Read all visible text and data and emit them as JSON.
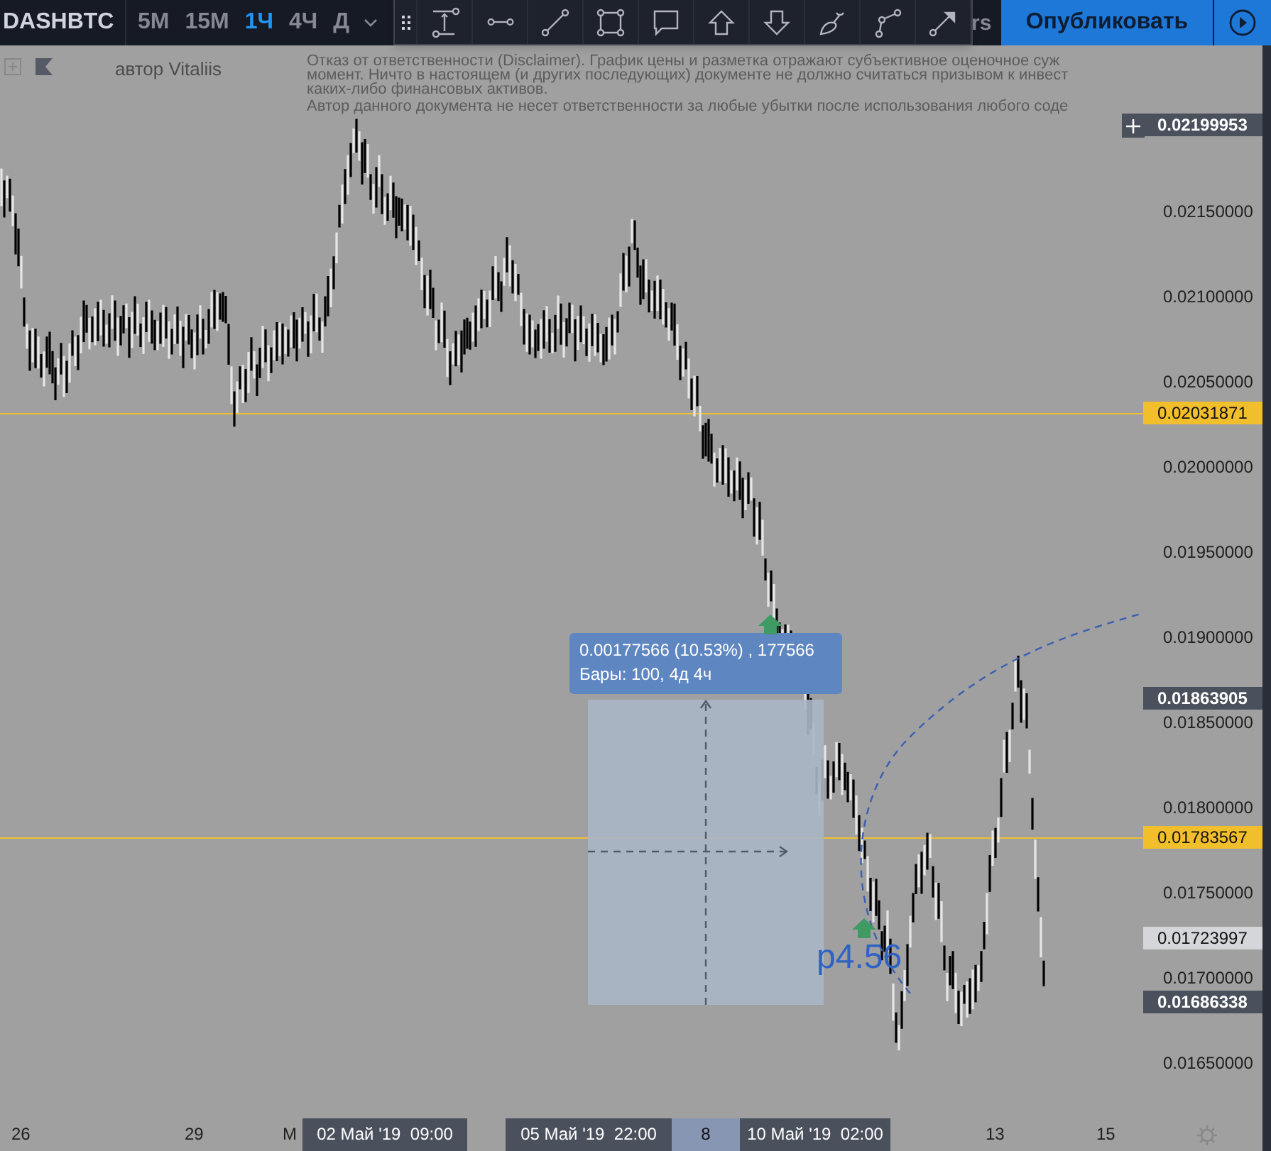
{
  "toolbar": {
    "symbol": "DASHBTC",
    "intervals": [
      {
        "label": "5M",
        "selected": false
      },
      {
        "label": "15M",
        "selected": false
      },
      {
        "label": "1Ч",
        "selected": true
      },
      {
        "label": "4Ч",
        "selected": false
      },
      {
        "label": "Д",
        "selected": false
      }
    ],
    "partial_text": "rs",
    "publish_button": "Опубликовать"
  },
  "legend": {
    "author": "автор Vitaliis"
  },
  "disclaimer": [
    "Отказ от ответственности (Disclaimer). График цены и разметка отражают субъективное оценочное суж",
    "момент. Ничто в настоящем (и других последующих) документе не должно считаться призывом к инвест",
    "каких-либо финансовых активов.",
    "Автор данного документа не несет ответственности за любые убытки после использования любого соде"
  ],
  "price_axis": {
    "ticks": [
      "0.02150000",
      "0.02100000",
      "0.02050000",
      "0.02000000",
      "0.01950000",
      "0.01900000",
      "0.01850000",
      "0.01800000",
      "0.01750000",
      "0.01700000",
      "0.01650000"
    ],
    "labels": [
      {
        "text": "0.02199953",
        "kind": "dark"
      },
      {
        "text": "0.02031871",
        "kind": "line"
      },
      {
        "text": "0.01863905",
        "kind": "dark"
      },
      {
        "text": "0.01783567",
        "kind": "line"
      },
      {
        "text": "0.01723997",
        "kind": "light"
      },
      {
        "text": "0.01686338",
        "kind": "dark"
      }
    ]
  },
  "time_axis": [
    {
      "text": "26",
      "kind": "plain"
    },
    {
      "text": "29",
      "kind": "plain"
    },
    {
      "text": "М",
      "kind": "plain"
    },
    {
      "text": "02 Май '19  09:00",
      "kind": "range"
    },
    {
      "text": "05 Май '19  22:00",
      "kind": "range"
    },
    {
      "text": "8",
      "kind": "current"
    },
    {
      "text": "10 Май '19  02:00",
      "kind": "range"
    },
    {
      "text": "13",
      "kind": "plain"
    },
    {
      "text": "15",
      "kind": "plain"
    }
  ],
  "measure": {
    "line_1": "0.00177566 (10.53%) , 177566",
    "line_2": "Бары: 100, 4д 4ч"
  },
  "annotation": "р4.56"
}
